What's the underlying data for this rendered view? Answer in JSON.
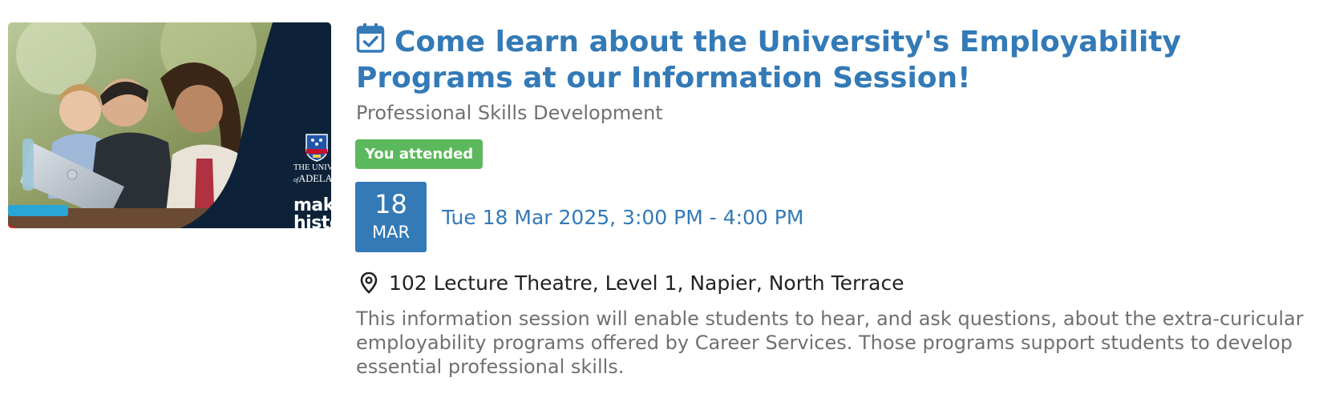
{
  "event": {
    "title": "Come learn about the University's Employability Programs at our Information Session!",
    "category": "Professional Skills Development",
    "attendance_badge": "You attended",
    "date_day": "18",
    "date_month": "MAR",
    "datetime": "Tue 18 Mar 2025, 3:00 PM - 4:00 PM",
    "location": "102 Lecture Theatre, Level 1, Napier, North Terrace",
    "description": "This information session will enable students to hear, and ask questions, about the extra-curicular employability programs offered by Career Services. Those programs support students to develop essential professional skills."
  },
  "thumbnail": {
    "uni_line1": "THE UNIVE",
    "uni_of": "of",
    "uni_line2": "ADELA",
    "tagline_1": "make",
    "tagline_2": "histo"
  },
  "icons": {
    "title_icon": "calendar-check-icon",
    "location_icon": "map-pin-icon"
  },
  "colors": {
    "link_blue": "#337ab7",
    "badge_green": "#5cb85c",
    "muted_text": "#707070",
    "brand_navy": "#0d2238"
  }
}
